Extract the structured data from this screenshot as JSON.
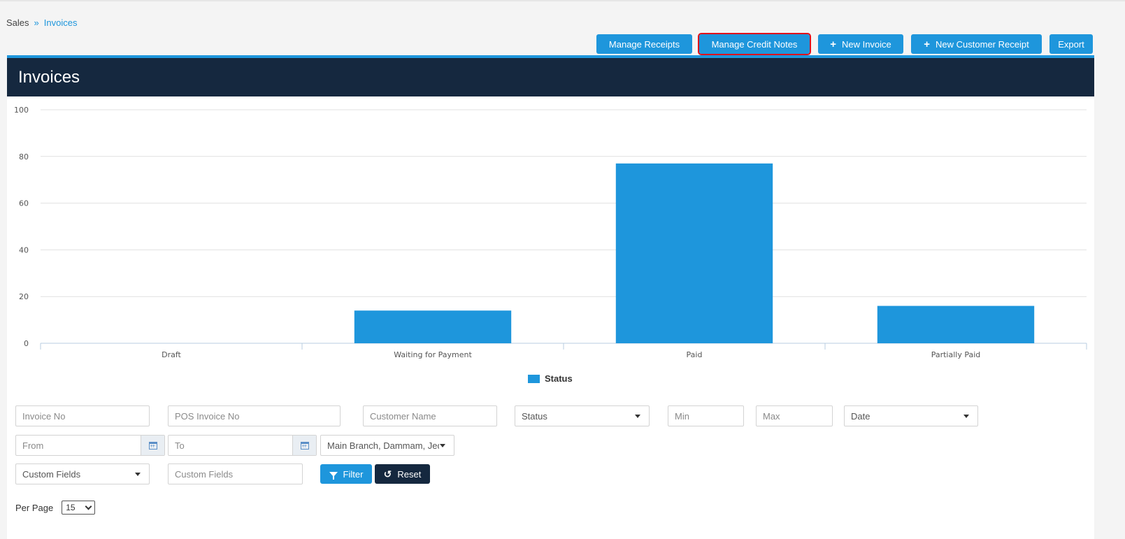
{
  "breadcrumb": {
    "parent": "Sales",
    "separator": "»",
    "current": "Invoices"
  },
  "actions": {
    "manage_receipts": "Manage Receipts",
    "manage_credit_notes": "Manage Credit Notes",
    "new_invoice": "New Invoice",
    "new_customer_receipt": "New Customer Receipt",
    "export": "Export",
    "plus_icon": "+"
  },
  "panel": {
    "title": "Invoices"
  },
  "chart_data": {
    "type": "bar",
    "categories": [
      "Draft",
      "Waiting for Payment",
      "Paid",
      "Partially Paid"
    ],
    "series": [
      {
        "name": "Status",
        "values": [
          0,
          14,
          77,
          16
        ],
        "color": "#1e96dc"
      }
    ],
    "ylim": [
      0,
      100
    ],
    "yticks": [
      0,
      20,
      40,
      60,
      80,
      100
    ],
    "grid": true,
    "legend": "bottom-center"
  },
  "filters": {
    "invoice_no": "Invoice No",
    "pos_invoice_no": "POS Invoice No",
    "customer_name": "Customer Name",
    "status": "Status",
    "min": "Min",
    "max": "Max",
    "date": "Date",
    "from": "From",
    "to": "To",
    "branch": "Main Branch, Dammam, Jed",
    "custom_fields_select": "Custom Fields",
    "custom_fields_input": "Custom Fields",
    "filter_button": "Filter",
    "reset_button": "Reset",
    "reset_icon": "↺"
  },
  "pagination": {
    "per_page_label": "Per Page",
    "per_page_value": "15"
  },
  "colors": {
    "accent": "#1e96dc",
    "header": "#15283f",
    "highlight": "#e0111b"
  }
}
